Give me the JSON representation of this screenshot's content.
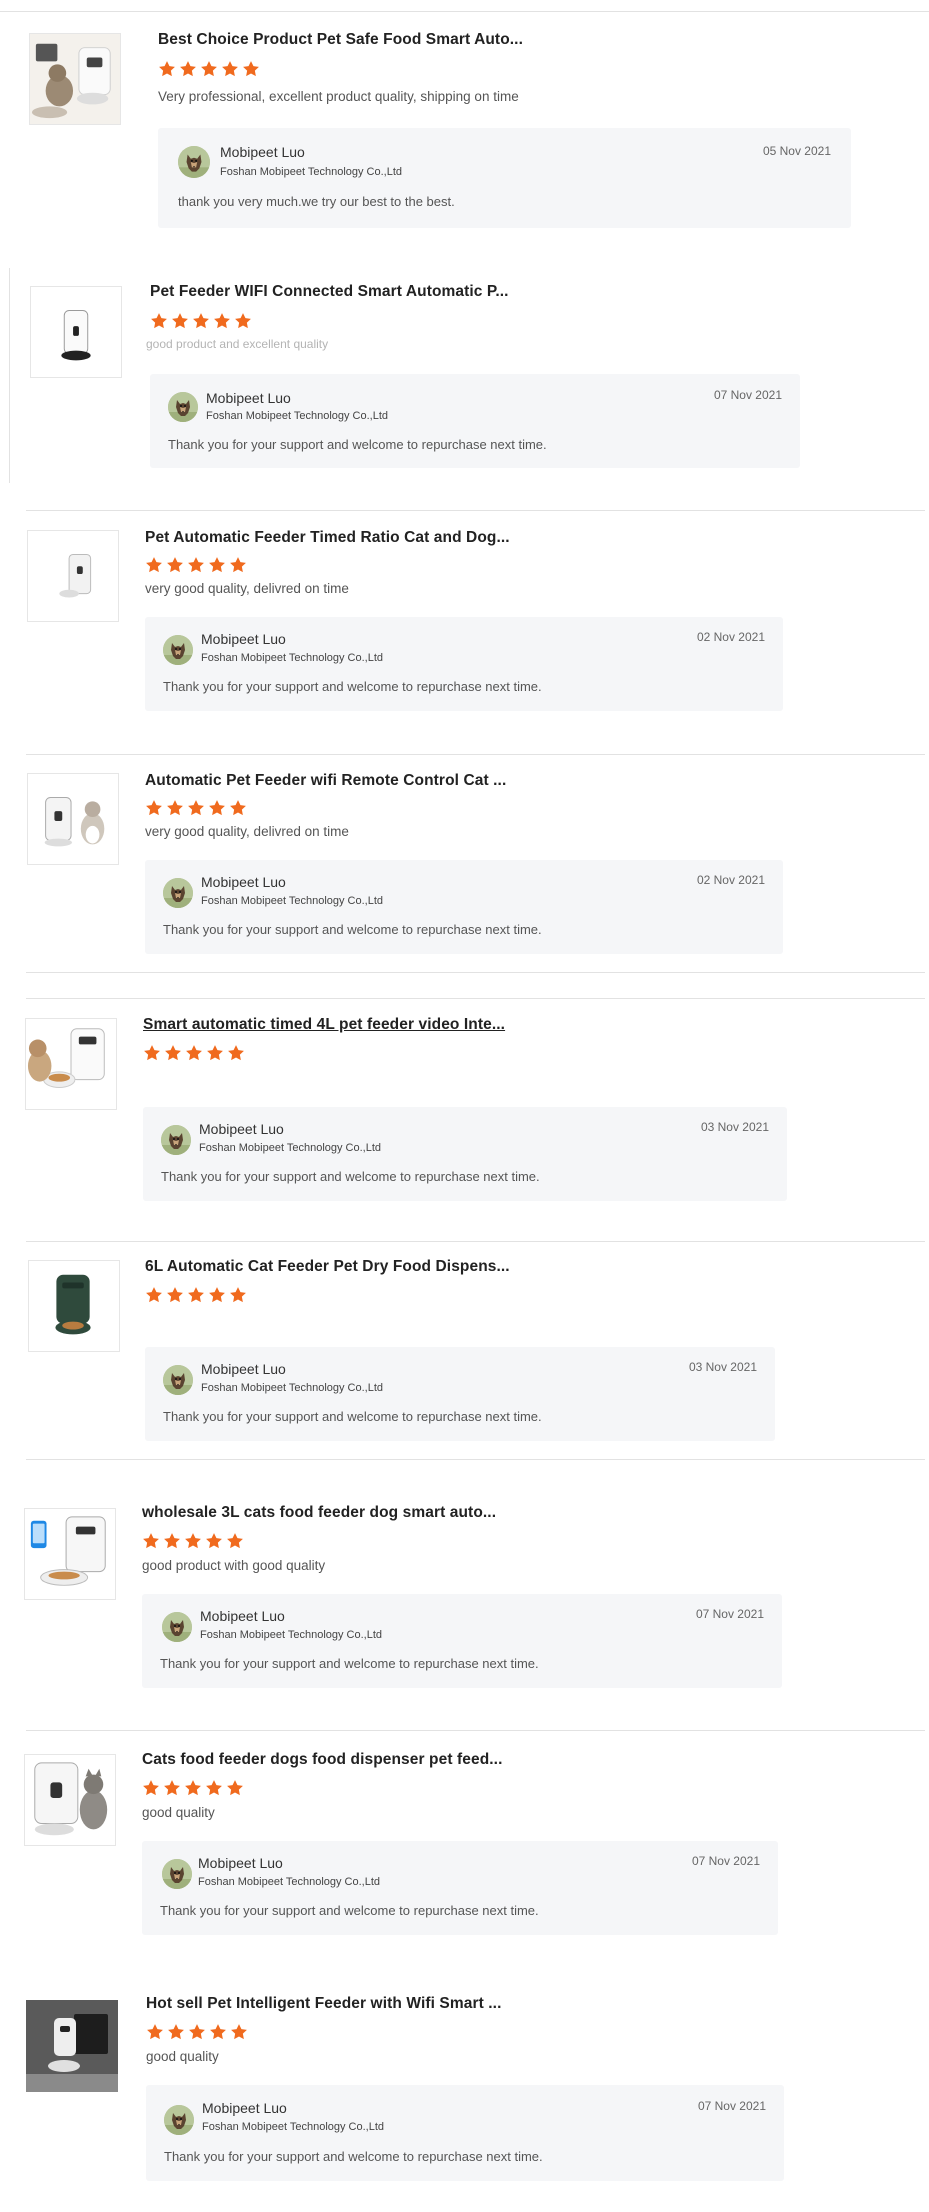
{
  "accent_color": "#f06a1e",
  "reviews": [
    {
      "product_title": "Best Choice Product Pet Safe Food Smart Auto...",
      "rating": 5,
      "comment": "Very professional, excellent product quality, shipping on time",
      "thumb_icon": "pet-feeder-with-cat-image",
      "reply": {
        "name": "Mobipeet Luo",
        "company": "Foshan Mobipeet Technology Co.,Ltd",
        "date": "05 Nov 2021",
        "text": "thank you very much.we try our best to the best."
      }
    },
    {
      "product_title": "Pet Feeder WIFI Connected Smart Automatic P...",
      "rating": 5,
      "comment": "good product and excellent quality",
      "thumb_icon": "pet-feeder-image",
      "reply": {
        "name": "Mobipeet Luo",
        "company": "Foshan Mobipeet Technology Co.,Ltd",
        "date": "07 Nov 2021",
        "text": "Thank you for your support and welcome to repurchase next time."
      }
    },
    {
      "product_title": "Pet Automatic Feeder Timed Ratio Cat and Dog...",
      "rating": 5,
      "comment": "very good quality, delivred on time",
      "thumb_icon": "pet-feeder-image",
      "reply": {
        "name": "Mobipeet Luo",
        "company": "Foshan Mobipeet Technology Co.,Ltd",
        "date": "02 Nov 2021",
        "text": "Thank you for your support and welcome to repurchase next time."
      }
    },
    {
      "product_title": "Automatic Pet Feeder wifi Remote Control Cat ...",
      "rating": 5,
      "comment": "very good quality, delivred on time",
      "thumb_icon": "pet-feeder-with-cat-image",
      "reply": {
        "name": "Mobipeet Luo",
        "company": "Foshan Mobipeet Technology Co.,Ltd",
        "date": "02 Nov 2021",
        "text": "Thank you for your support and welcome to repurchase next time."
      }
    },
    {
      "product_title": "Smart automatic timed 4L pet feeder video Inte...",
      "rating": 5,
      "comment": "",
      "thumb_icon": "pet-feeder-with-dog-image",
      "reply": {
        "name": "Mobipeet Luo",
        "company": "Foshan Mobipeet Technology Co.,Ltd",
        "date": "03 Nov 2021",
        "text": "Thank you for your support and welcome to repurchase next time."
      }
    },
    {
      "product_title": "6L Automatic Cat Feeder Pet Dry Food Dispens...",
      "rating": 5,
      "comment": "",
      "thumb_icon": "green-pet-feeder-image",
      "reply": {
        "name": "Mobipeet Luo",
        "company": "Foshan Mobipeet Technology Co.,Ltd",
        "date": "03 Nov 2021",
        "text": "Thank you for your support and welcome to repurchase next time."
      }
    },
    {
      "product_title": "wholesale 3L cats food feeder dog smart auto...",
      "rating": 5,
      "comment": "good product with good quality",
      "thumb_icon": "pet-feeder-with-phone-image",
      "reply": {
        "name": "Mobipeet Luo",
        "company": "Foshan Mobipeet Technology Co.,Ltd",
        "date": "07 Nov 2021",
        "text": "Thank you for your support and welcome to repurchase next time."
      }
    },
    {
      "product_title": "Cats food feeder dogs food dispenser pet feed...",
      "rating": 5,
      "comment": "good quality",
      "thumb_icon": "pet-feeder-with-cat-image",
      "reply": {
        "name": "Mobipeet Luo",
        "company": "Foshan Mobipeet Technology Co.,Ltd",
        "date": "07 Nov 2021",
        "text": "Thank you for your support and welcome to repurchase next time."
      }
    },
    {
      "product_title": "Hot sell Pet Intelligent Feeder with Wifi Smart ...",
      "rating": 5,
      "comment": "good quality",
      "thumb_icon": "dark-room-pet-feeder-image",
      "reply": {
        "name": "Mobipeet Luo",
        "company": "Foshan Mobipeet Technology Co.,Ltd",
        "date": "07 Nov 2021",
        "text": "Thank you for your support and welcome to repurchase next time."
      }
    }
  ]
}
